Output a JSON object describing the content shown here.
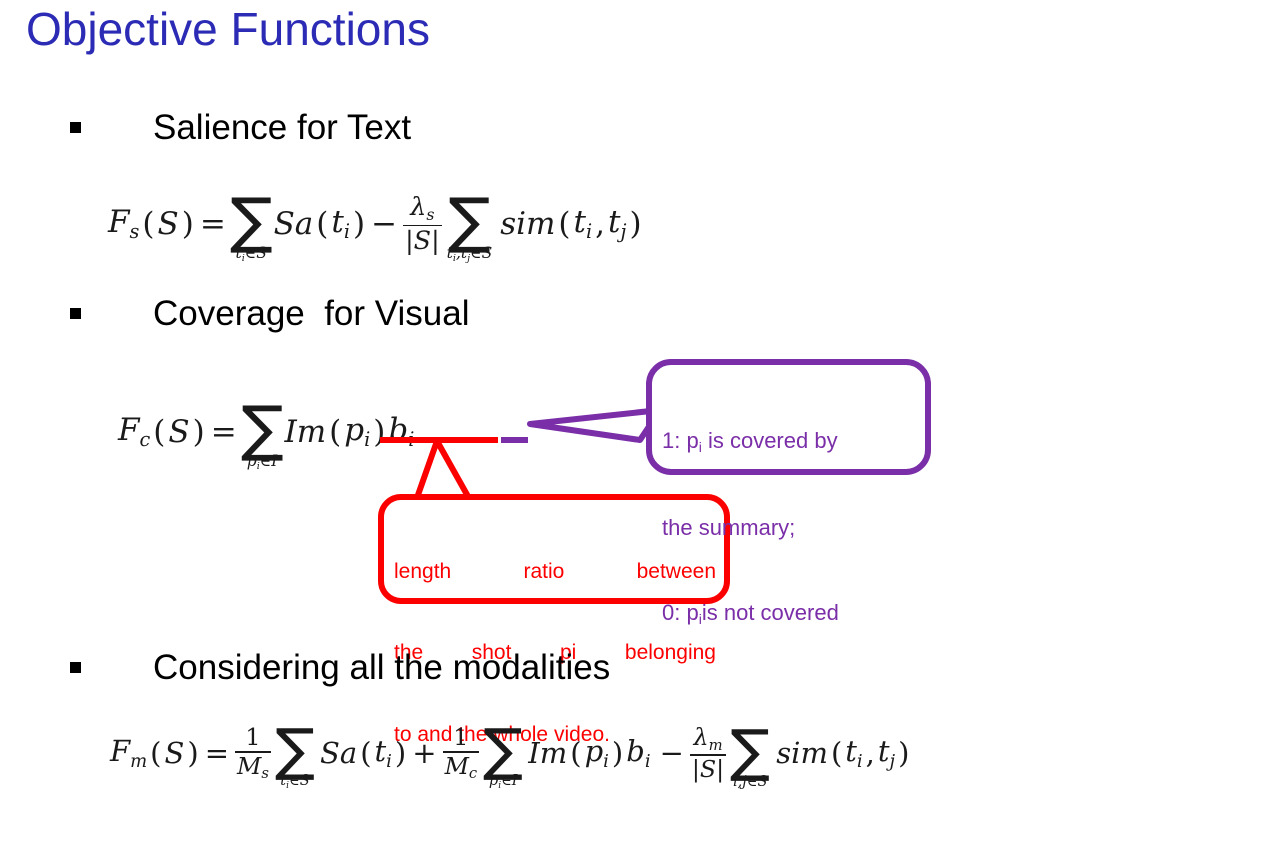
{
  "slide": {
    "title": "Objective Functions",
    "title_color": "#2b2bb5",
    "background": "#ffffff"
  },
  "bullets": [
    {
      "label": "Salience for Text"
    },
    {
      "label": "Coverage  for Visual"
    },
    {
      "label": "Considering all the modalities"
    }
  ],
  "formulas": {
    "salience": {
      "id": "F_s",
      "latex": "\\mathcal{F}_s(S) = \\sum_{t_i \\in S} Sa(t_i) - \\frac{\\lambda_s}{|S|} \\sum_{t_i,t_j \\in S} sim(t_i,t_j)",
      "lhs": "Fs(S)",
      "parts": {
        "func_name": "F",
        "func_sub": "s",
        "arg": "(S)",
        "equals": "=",
        "sum1_limit": "tᵢ∈S",
        "term1": "Sa(tᵢ)",
        "minus": "−",
        "frac_num": "λₛ",
        "frac_den": "|S|",
        "sum2_limit": "tᵢ,tⱼ∈S",
        "term2": "sim(tᵢ,tⱼ)"
      }
    },
    "coverage": {
      "id": "F_c",
      "latex": "\\mathcal{F}_c(S) = \\sum_{p_i \\in I} Im(p_i) b_i",
      "parts": {
        "func_name": "F",
        "func_sub": "c",
        "arg": "(S)",
        "equals": "=",
        "sum_limit": "pᵢ∈I",
        "term_im": "Im(pᵢ)",
        "term_b": "bᵢ"
      }
    },
    "multimodal": {
      "id": "F_m",
      "latex": "\\mathcal{F}_m(S) = \\frac{1}{M_s}\\sum_{t_i \\in S} Sa(t_i) + \\frac{1}{M_c}\\sum_{p_i \\in I} Im(p_i) b_i - \\frac{\\lambda_m}{|S|}\\sum_{i,j \\in S} sim(t_i,t_j)",
      "parts": {
        "func_name": "F",
        "func_sub": "m",
        "arg": "(S)",
        "equals": "=",
        "frac1_num": "1",
        "frac1_den": "Mₛ",
        "sum1_limit": "tᵢ∈S",
        "term1": "Sa(tᵢ)",
        "plus": "+",
        "frac2_num": "1",
        "frac2_den": "M_c",
        "sum2_limit": "pᵢ∈I",
        "term2_im": "Im(pᵢ)",
        "term2_b": "bᵢ",
        "minus": "−",
        "frac3_num": "λₘ",
        "frac3_den": "|S|",
        "sum3_limit": "i,j∈S",
        "term3": "sim(tᵢ,tⱼ)"
      }
    }
  },
  "annotations": {
    "purple": {
      "color": "#7a2ea8",
      "target": "b_i",
      "lines": [
        {
          "pre": "1: p",
          "sub": "i",
          "post": " is covered by"
        },
        {
          "pre": "the summary;",
          "sub": "",
          "post": ""
        },
        {
          "pre": "0: p",
          "sub": "i",
          "post": "is not covered"
        }
      ],
      "plain_text": "1: p_i is covered by the summary; 0: p_i is not covered"
    },
    "red": {
      "color": "#fc0000",
      "target": "Im(p_i)",
      "lines": [
        "length ratio between",
        "the shot pi belonging",
        "to and the whole video."
      ],
      "plain_text": "length ratio between the shot pi belonging to and the whole video."
    }
  }
}
